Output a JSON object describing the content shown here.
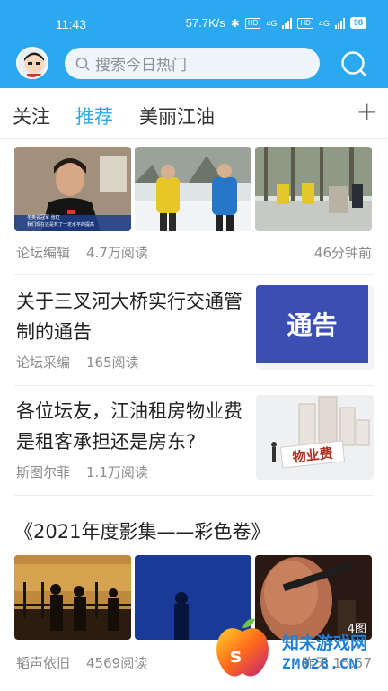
{
  "status_bar": {
    "time": "11:43",
    "net_speed": "57.7K/s",
    "hd1": "HD",
    "net1": "4G",
    "hd2": "HD",
    "net2": "4G",
    "battery": "98"
  },
  "header": {
    "search_placeholder": "搜索今日热门",
    "bg_color": "#2aa8f0"
  },
  "tabs": [
    {
      "label": "关注",
      "active": false
    },
    {
      "label": "推荐",
      "active": true
    },
    {
      "label": "美丽江油",
      "active": false
    }
  ],
  "tab_add_label": "+",
  "feed": {
    "post1": {
      "author": "论坛编辑",
      "reads": "4.7万阅读",
      "time": "46分钟前",
      "video_caption_top": "冬奥会冠军 张虹",
      "video_caption_bottom": "我们现在还是有了一定水平的提高"
    },
    "post2": {
      "title": "关于三叉河大桥实行交通管制的通告",
      "author": "论坛采编",
      "reads": "165阅读",
      "thumb_text": "通告"
    },
    "post3": {
      "title": "各位坛友，江油租房物业费是租客承担还是房东?",
      "author": "斯图尔菲",
      "reads": "1.1万阅读",
      "thumb_text": "物业费"
    },
    "post4": {
      "title": "《2021年度影集——彩色卷》",
      "author": "韬声依旧",
      "reads": "4569阅读",
      "time": "昨天 15:57",
      "photo_count": "4图"
    }
  },
  "watermark": {
    "line1": "知未游戏网",
    "line2": "ZM028.CN"
  }
}
